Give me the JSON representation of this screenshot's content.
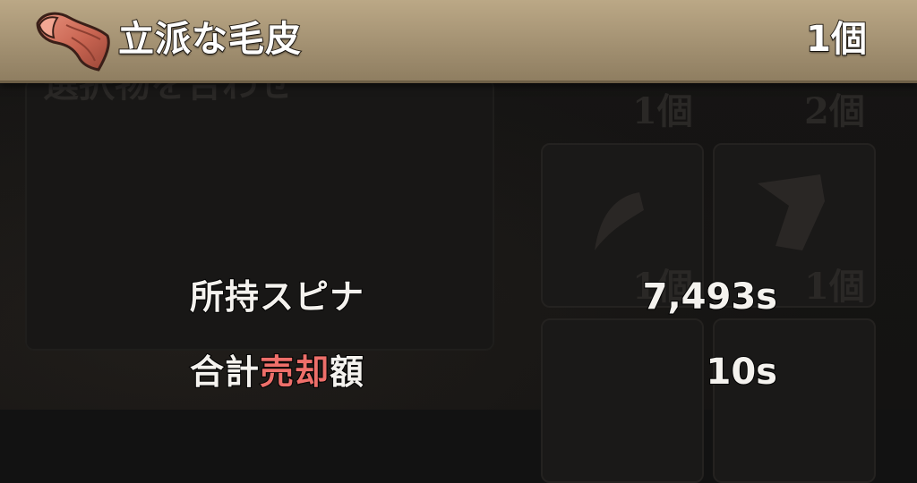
{
  "item": {
    "name": "立派な毛皮",
    "count": "1個",
    "icon": "fur-pelt-icon"
  },
  "info": {
    "held_spina_label": "所持スピナ",
    "held_spina_value": "7,493s",
    "total_sale_label_prefix": "合計",
    "total_sale_label_accent": "売却",
    "total_sale_label_suffix": "額",
    "total_sale_value": "10s"
  },
  "background": {
    "faded_title": "選択物を合わせ",
    "slot_counts": [
      "1個",
      "2個",
      "1個",
      "1個"
    ]
  },
  "colors": {
    "header_bar": "#a39172",
    "accent_text": "#ee6f6a",
    "text": "#f4f2ee",
    "background": "#121212"
  }
}
